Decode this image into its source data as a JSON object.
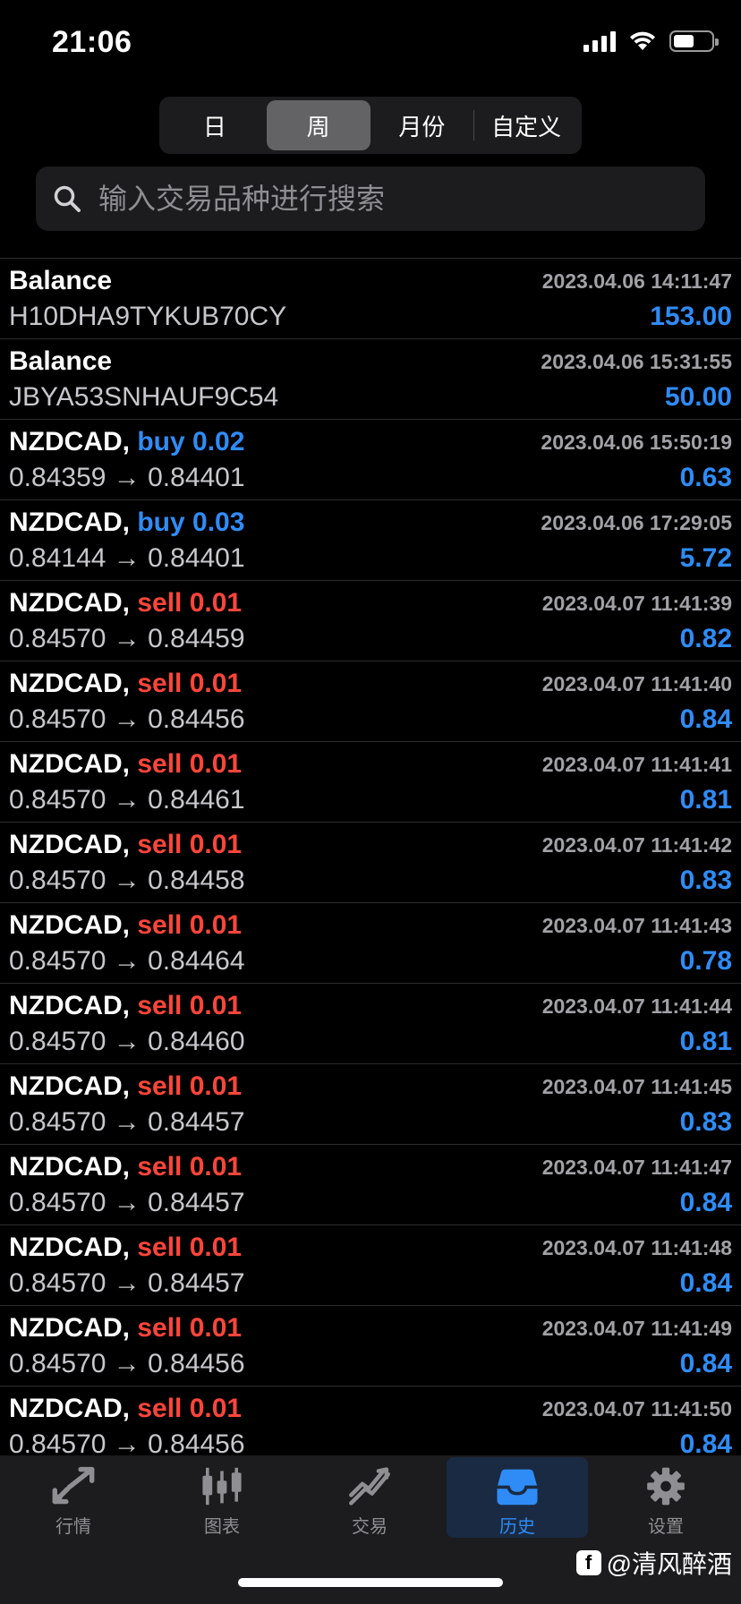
{
  "status_bar": {
    "time": "21:06",
    "battery_level": 0.55
  },
  "segments": [
    {
      "label": "日",
      "active": false
    },
    {
      "label": "周",
      "active": true
    },
    {
      "label": "月份",
      "active": false
    },
    {
      "label": "自定义",
      "active": false
    }
  ],
  "search": {
    "placeholder": "输入交易品种进行搜索",
    "value": ""
  },
  "rows": [
    {
      "symbol": "Balance",
      "side": "",
      "side_type": "",
      "sub": "H10DHA9TYKUB70CY",
      "time": "2023.04.06 14:11:47",
      "profit": "153.00"
    },
    {
      "symbol": "Balance",
      "side": "",
      "side_type": "",
      "sub": "JBYA53SNHAUF9C54",
      "time": "2023.04.06 15:31:55",
      "profit": "50.00"
    },
    {
      "symbol": "NZDCAD,",
      "side": "buy 0.02",
      "side_type": "buy",
      "sub": "0.84359 → 0.84401",
      "time": "2023.04.06 15:50:19",
      "profit": "0.63"
    },
    {
      "symbol": "NZDCAD,",
      "side": "buy 0.03",
      "side_type": "buy",
      "sub": "0.84144 → 0.84401",
      "time": "2023.04.06 17:29:05",
      "profit": "5.72"
    },
    {
      "symbol": "NZDCAD,",
      "side": "sell 0.01",
      "side_type": "sell",
      "sub": "0.84570 → 0.84459",
      "time": "2023.04.07 11:41:39",
      "profit": "0.82"
    },
    {
      "symbol": "NZDCAD,",
      "side": "sell 0.01",
      "side_type": "sell",
      "sub": "0.84570 → 0.84456",
      "time": "2023.04.07 11:41:40",
      "profit": "0.84"
    },
    {
      "symbol": "NZDCAD,",
      "side": "sell 0.01",
      "side_type": "sell",
      "sub": "0.84570 → 0.84461",
      "time": "2023.04.07 11:41:41",
      "profit": "0.81"
    },
    {
      "symbol": "NZDCAD,",
      "side": "sell 0.01",
      "side_type": "sell",
      "sub": "0.84570 → 0.84458",
      "time": "2023.04.07 11:41:42",
      "profit": "0.83"
    },
    {
      "symbol": "NZDCAD,",
      "side": "sell 0.01",
      "side_type": "sell",
      "sub": "0.84570 → 0.84464",
      "time": "2023.04.07 11:41:43",
      "profit": "0.78"
    },
    {
      "symbol": "NZDCAD,",
      "side": "sell 0.01",
      "side_type": "sell",
      "sub": "0.84570 → 0.84460",
      "time": "2023.04.07 11:41:44",
      "profit": "0.81"
    },
    {
      "symbol": "NZDCAD,",
      "side": "sell 0.01",
      "side_type": "sell",
      "sub": "0.84570 → 0.84457",
      "time": "2023.04.07 11:41:45",
      "profit": "0.83"
    },
    {
      "symbol": "NZDCAD,",
      "side": "sell 0.01",
      "side_type": "sell",
      "sub": "0.84570 → 0.84457",
      "time": "2023.04.07 11:41:47",
      "profit": "0.84"
    },
    {
      "symbol": "NZDCAD,",
      "side": "sell 0.01",
      "side_type": "sell",
      "sub": "0.84570 → 0.84457",
      "time": "2023.04.07 11:41:48",
      "profit": "0.84"
    },
    {
      "symbol": "NZDCAD,",
      "side": "sell 0.01",
      "side_type": "sell",
      "sub": "0.84570 → 0.84456",
      "time": "2023.04.07 11:41:49",
      "profit": "0.84"
    },
    {
      "symbol": "NZDCAD,",
      "side": "sell 0.01",
      "side_type": "sell",
      "sub": "0.84570 → 0.84456",
      "time": "2023.04.07 11:41:50",
      "profit": "0.84"
    }
  ],
  "tabs": [
    {
      "label": "行情",
      "icon": "quotes-icon",
      "active": false
    },
    {
      "label": "图表",
      "icon": "chart-icon",
      "active": false
    },
    {
      "label": "交易",
      "icon": "trade-icon",
      "active": false
    },
    {
      "label": "历史",
      "icon": "history-icon",
      "active": true
    },
    {
      "label": "设置",
      "icon": "settings-icon",
      "active": false
    }
  ],
  "watermark": {
    "text": "@清风醉酒"
  },
  "colors": {
    "accent": "#2f8cf6",
    "sell": "#ff453a",
    "background": "#000000"
  }
}
